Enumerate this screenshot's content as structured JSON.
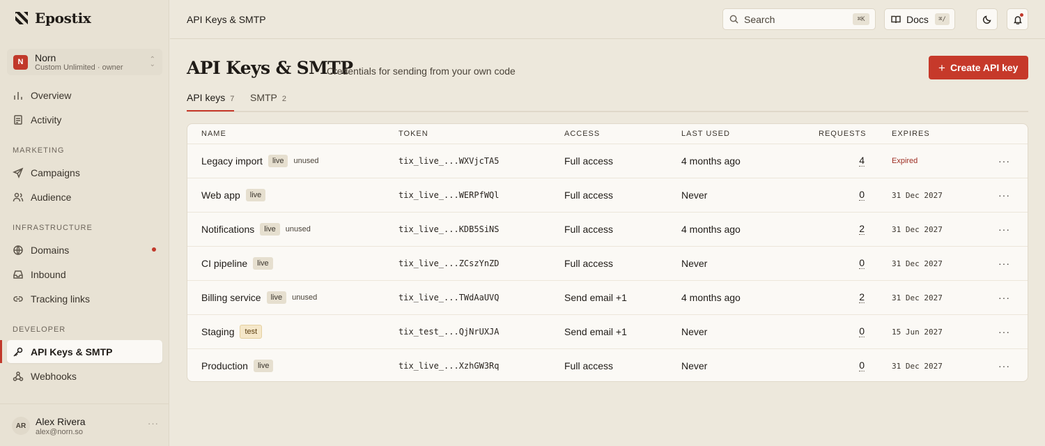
{
  "app": {
    "brand": "Epostix"
  },
  "workspace": {
    "initial": "N",
    "name": "Norn",
    "plan": "Custom Unlimited · owner"
  },
  "sidebar": {
    "items_top": [
      {
        "label": "Overview",
        "icon": "chart-icon"
      },
      {
        "label": "Activity",
        "icon": "activity-icon"
      }
    ],
    "sections": {
      "marketing": "MARKETING",
      "infrastructure": "INFRASTRUCTURE",
      "developer": "DEVELOPER"
    },
    "marketing": [
      {
        "label": "Campaigns",
        "icon": "send-icon"
      },
      {
        "label": "Audience",
        "icon": "users-icon"
      }
    ],
    "infrastructure": [
      {
        "label": "Domains",
        "icon": "globe-icon"
      },
      {
        "label": "Inbound",
        "icon": "inbox-icon"
      },
      {
        "label": "Tracking links",
        "icon": "link-icon"
      }
    ],
    "developer": [
      {
        "label": "API Keys & SMTP",
        "icon": "key-icon"
      },
      {
        "label": "Webhooks",
        "icon": "webhook-icon"
      }
    ]
  },
  "user": {
    "initials": "AR",
    "name": "Alex Rivera",
    "email": "alex@norn.so",
    "more": "···"
  },
  "topbar": {
    "breadcrumb": "API Keys & SMTP",
    "search_placeholder": "Search",
    "search_shortcut": "⌘K",
    "docs_label": "Docs",
    "docs_shortcut": "⌘/"
  },
  "page": {
    "title": "API Keys & SMTP",
    "subtitle": "Credentials for sending from your own code",
    "create_button": "Create API key",
    "create_icon": "+"
  },
  "tabs": [
    {
      "label": "API keys",
      "count": "7"
    },
    {
      "label": "SMTP",
      "count": "2"
    }
  ],
  "table": {
    "headers": [
      "NAME",
      "TOKEN",
      "ACCESS",
      "LAST USED",
      "REQUESTS",
      "EXPIRES"
    ],
    "rows": [
      {
        "name": "Legacy import",
        "badge": "live",
        "unused": "unused",
        "token": "tix_live_...WXVjcTA5",
        "access": "Full access",
        "last_used": "4 months ago",
        "requests": "4",
        "expires": "Expired",
        "menu": "···"
      },
      {
        "name": "Web app",
        "badge": "live",
        "unused": "",
        "token": "tix_live_...WERPfWQl",
        "access": "Full access",
        "last_used": "Never",
        "requests": "0",
        "expires": "31 Dec 2027",
        "menu": "···"
      },
      {
        "name": "Notifications",
        "badge": "live",
        "unused": "unused",
        "token": "tix_live_...KDB5SiNS",
        "access": "Full access",
        "last_used": "4 months ago",
        "requests": "2",
        "expires": "31 Dec 2027",
        "menu": "···"
      },
      {
        "name": "CI pipeline",
        "badge": "live",
        "unused": "",
        "token": "tix_live_...ZCszYnZD",
        "access": "Full access",
        "last_used": "Never",
        "requests": "0",
        "expires": "31 Dec 2027",
        "menu": "···"
      },
      {
        "name": "Billing service",
        "badge": "live",
        "unused": "unused",
        "token": "tix_live_...TWdAaUVQ",
        "access": "Send email +1",
        "last_used": "4 months ago",
        "requests": "2",
        "expires": "31 Dec 2027",
        "menu": "···"
      },
      {
        "name": "Staging",
        "badge": "test",
        "unused": "",
        "token": "tix_test_...QjNrUXJA",
        "access": "Send email +1",
        "last_used": "Never",
        "requests": "0",
        "expires": "15 Jun 2027",
        "menu": "···"
      },
      {
        "name": "Production",
        "badge": "live",
        "unused": "",
        "token": "tix_live_...XzhGW3Rq",
        "access": "Full access",
        "last_used": "Never",
        "requests": "0",
        "expires": "31 Dec 2027",
        "menu": "···"
      }
    ]
  },
  "colors": {
    "accent": "#c6392a",
    "background": "#ede8dc",
    "sidebar": "#e8e2d4",
    "card": "#fbf9f5"
  }
}
